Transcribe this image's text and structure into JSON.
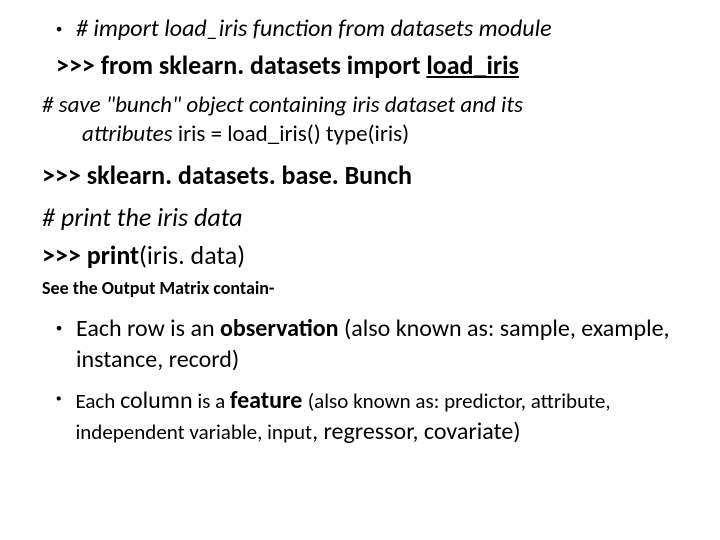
{
  "line1": "# import load_iris function from datasets module",
  "line2_prefix": ">>> from sklearn. datasets import ",
  "line2_under": "load_iris",
  "line3_a": "# save \"bunch\" object containing iris dataset and its",
  "line3_b_italic": "attributes",
  "line3_b_rest": " iris = load_iris() type(iris)",
  "line4": ">>> sklearn. datasets. base. Bunch",
  "line5": "# print the iris data",
  "line6_a": ">>> ",
  "line6_b": "print",
  "line6_c": "(iris. data)",
  "line7": "See the Output Matrix contain-",
  "bullet1_a": "Each ",
  "bullet1_row": "row",
  "bullet1_b": " is an ",
  "bullet1_obs": "observation",
  "bullet1_c": " (also known as: sample, example, instance, record)",
  "bullet2_a": "Each ",
  "bullet2_col": "column",
  "bullet2_b": " is a ",
  "bullet2_feat": "feature ",
  "bullet2_c": "(also known as: predictor, attribute, independent variable, input",
  "bullet2_d": ", regressor, covariate)"
}
